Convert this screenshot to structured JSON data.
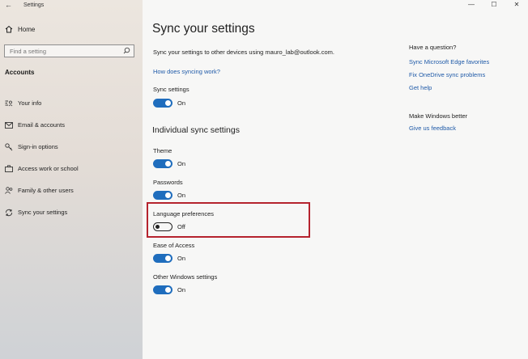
{
  "window": {
    "title": "Settings",
    "controls": [
      "—",
      "☐",
      "✕"
    ]
  },
  "sidebar": {
    "home_label": "Home",
    "search_placeholder": "Find a setting",
    "section_title": "Accounts",
    "items": [
      {
        "label": "Your info",
        "icon": "person-card-icon"
      },
      {
        "label": "Email & accounts",
        "icon": "email-icon"
      },
      {
        "label": "Sign-in options",
        "icon": "key-icon"
      },
      {
        "label": "Access work or school",
        "icon": "briefcase-icon"
      },
      {
        "label": "Family & other users",
        "icon": "people-icon"
      },
      {
        "label": "Sync your settings",
        "icon": "sync-icon"
      }
    ]
  },
  "main": {
    "title": "Sync your settings",
    "description": "Sync your settings to other devices using mauro_lab@outlook.com.",
    "how_link": "How does syncing work?",
    "sync_settings": {
      "label": "Sync settings",
      "state": "On"
    },
    "individual_heading": "Individual sync settings",
    "individual": [
      {
        "label": "Theme",
        "state": "On"
      },
      {
        "label": "Passwords",
        "state": "On"
      },
      {
        "label": "Language preferences",
        "state": "Off"
      },
      {
        "label": "Ease of Access",
        "state": "On"
      },
      {
        "label": "Other Windows settings",
        "state": "On"
      }
    ]
  },
  "right": {
    "question_heading": "Have a question?",
    "question_links": [
      "Sync Microsoft Edge favorites",
      "Fix OneDrive sync problems",
      "Get help"
    ],
    "better_heading": "Make Windows better",
    "better_link": "Give us feedback"
  },
  "colors": {
    "accent": "#1f6dbd",
    "link": "#1f5aa8",
    "highlight": "#b5232e"
  }
}
